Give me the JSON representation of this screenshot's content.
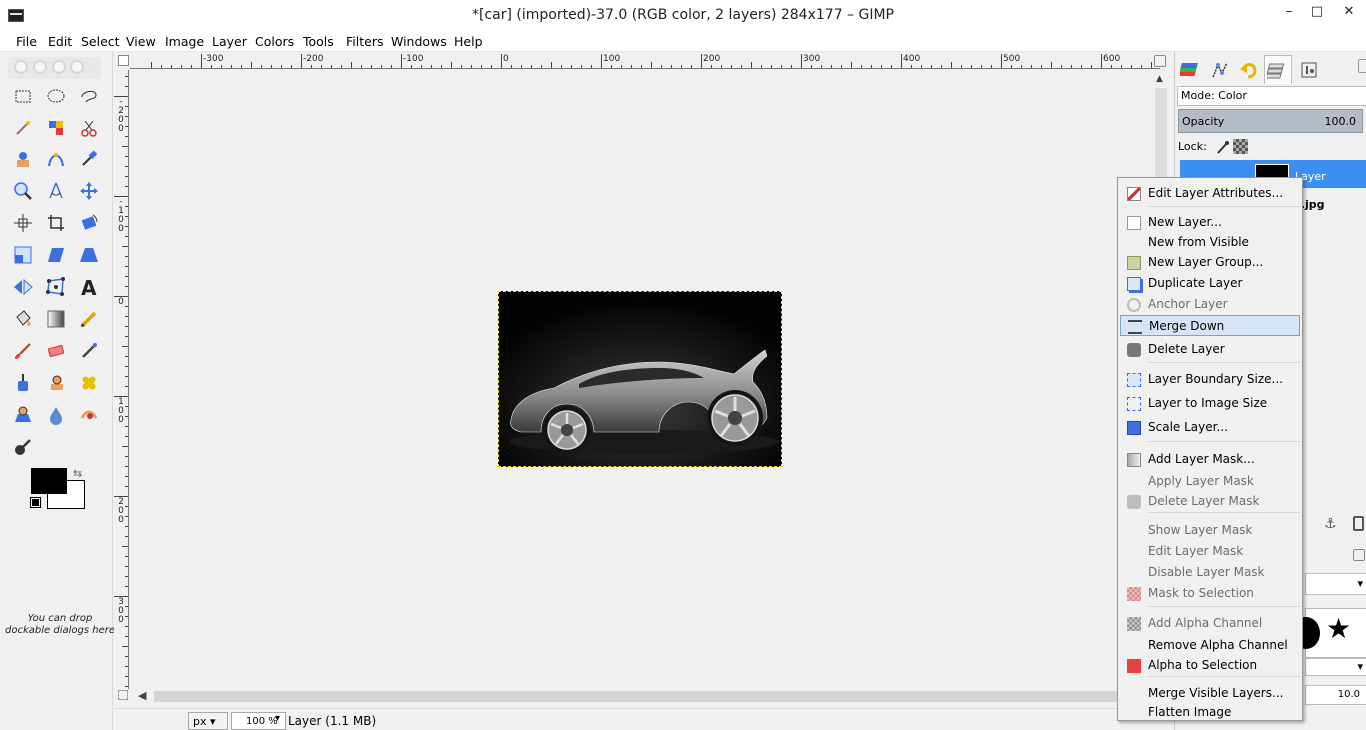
{
  "window": {
    "title": "*[car] (imported)-37.0 (RGB color, 2 layers) 284x177 – GIMP",
    "minimize_glyph": "–",
    "maximize_glyph": "□",
    "close_glyph": "✕"
  },
  "menubar": [
    "File",
    "Edit",
    "Select",
    "View",
    "Image",
    "Layer",
    "Colors",
    "Tools",
    "Filters",
    "Windows",
    "Help"
  ],
  "toolbox": {
    "tools": [
      "rect-select-icon",
      "ellipse-select-icon",
      "free-select-icon",
      "fuzzy-select-icon",
      "select-by-color-icon",
      "scissors-icon",
      "foreground-select-icon",
      "paths-icon",
      "color-picker-icon",
      "zoom-icon",
      "measure-icon",
      "move-icon",
      "align-icon",
      "crop-icon",
      "rotate-icon",
      "scale-icon",
      "shear-icon",
      "perspective-icon",
      "flip-icon",
      "cage-transform-icon",
      "text-icon",
      "bucket-fill-icon",
      "blend-icon",
      "pencil-icon",
      "paintbrush-icon",
      "eraser-icon",
      "airbrush-icon",
      "ink-icon",
      "clone-icon",
      "heal-icon",
      "perspective-clone-icon",
      "blur-sharpen-icon",
      "smudge-icon",
      "dodge-burn-icon"
    ],
    "swap_glyph": "⇆",
    "drop_hint": "You can drop dockable dialogs here",
    "foreground_color": "#000000",
    "background_color": "#ffffff"
  },
  "rulers": {
    "h_labels": [
      "-300",
      "-200",
      "-100",
      "0",
      "100",
      "200",
      "300",
      "400",
      "500",
      "600"
    ],
    "v_labels": [
      "-200",
      "-100",
      "0",
      "100",
      "200",
      "300"
    ]
  },
  "canvas": {
    "image_description_label": "car"
  },
  "status": {
    "unit": "px",
    "zoom": "100 %",
    "text": "Layer (1.1 MB)"
  },
  "dock": {
    "tabs": [
      "layers-tab-icon",
      "channels-tab-icon",
      "undo-tab-icon",
      "paths-tab-icon",
      "device-status-tab-icon"
    ],
    "mode_label": "Mode: Color",
    "opacity_label": "Opacity",
    "opacity_value": "100.0",
    "lock_label": "Lock:",
    "layers": [
      {
        "name": "Layer",
        "selected": true
      },
      {
        "name": "r.jpg",
        "selected": false
      }
    ],
    "spacing_value": "10.0",
    "accent_color": "#3c8ff0"
  },
  "context_menu": {
    "items": [
      {
        "label": "Edit Layer Attributes...",
        "icon": "edit-icon",
        "enabled": true
      },
      {
        "label": "New Layer...",
        "icon": "new-layer-icon",
        "enabled": true
      },
      {
        "label": "New from Visible",
        "icon": "",
        "enabled": true
      },
      {
        "label": "New Layer Group...",
        "icon": "folder-icon",
        "enabled": true
      },
      {
        "label": "Duplicate Layer",
        "icon": "duplicate-icon",
        "enabled": true
      },
      {
        "label": "Anchor Layer",
        "icon": "anchor-icon",
        "enabled": false
      },
      {
        "label": "Merge Down",
        "icon": "merge-icon",
        "enabled": true,
        "hover": true
      },
      {
        "label": "Delete Layer",
        "icon": "delete-icon",
        "enabled": true
      },
      {
        "label": "Layer Boundary Size...",
        "icon": "boundary-size-icon",
        "enabled": true
      },
      {
        "label": "Layer to Image Size",
        "icon": "layer-to-image-icon",
        "enabled": true
      },
      {
        "label": "Scale Layer...",
        "icon": "scale-layer-icon",
        "enabled": true
      },
      {
        "label": "Add Layer Mask...",
        "icon": "add-mask-icon",
        "enabled": true
      },
      {
        "label": "Apply Layer Mask",
        "icon": "",
        "enabled": false
      },
      {
        "label": "Delete Layer Mask",
        "icon": "delete-mask-icon",
        "enabled": false
      },
      {
        "label": "Show Layer Mask",
        "icon": "",
        "enabled": false
      },
      {
        "label": "Edit Layer Mask",
        "icon": "",
        "enabled": false
      },
      {
        "label": "Disable Layer Mask",
        "icon": "",
        "enabled": false
      },
      {
        "label": "Mask to Selection",
        "icon": "mask-selection-icon",
        "enabled": false
      },
      {
        "label": "Add Alpha Channel",
        "icon": "alpha-icon",
        "enabled": false
      },
      {
        "label": "Remove Alpha Channel",
        "icon": "",
        "enabled": true
      },
      {
        "label": "Alpha to Selection",
        "icon": "alpha-selection-icon",
        "enabled": true
      },
      {
        "label": "Merge Visible Layers...",
        "icon": "",
        "enabled": true
      },
      {
        "label": "Flatten Image",
        "icon": "",
        "enabled": true
      }
    ]
  }
}
